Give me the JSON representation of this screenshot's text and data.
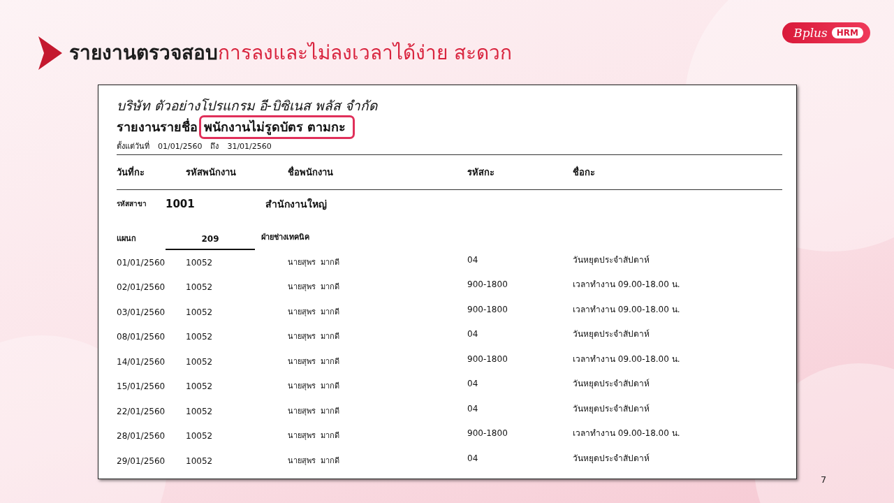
{
  "slide": {
    "title_lead": "รายงานตรวจสอบ",
    "title_rest": "การลงและไม่ลงเวลาได้ง่าย สะดวก",
    "page_number": "7"
  },
  "logo": {
    "brand": "Bplus",
    "badge": "HRM"
  },
  "report": {
    "company": "บริษัท ตัวอย่างโปรแกรม อี-บิซิเนส พลัส  จำกัด",
    "title": "รายงานรายชื่อ",
    "title_highlight": "พนักงานไม่รูดบัตร ตามกะ",
    "date_range": [
      "ตั้งแต่วันที่",
      "01/01/2560",
      "ถึง",
      "31/01/2560"
    ],
    "columns": [
      "วันที่กะ",
      "รหัสพนักงาน",
      "ชื่อพนักงาน",
      "รหัสกะ",
      "ชื่อกะ"
    ],
    "branch": {
      "label": "รหัสสาขา",
      "code": "1001",
      "name": "สำนักงานใหญ่"
    },
    "department": {
      "label": "แผนก",
      "code": "209",
      "name": "ฝ่ายช่างเทคนิค"
    },
    "rows": [
      {
        "date": "01/01/2560",
        "employee_code": "10052",
        "employee_name": "นายสุพร  มากดี",
        "shift_code": "04",
        "shift_name": "วันหยุดประจำสัปดาห์"
      },
      {
        "date": "02/01/2560",
        "employee_code": "10052",
        "employee_name": "นายสุพร  มากดี",
        "shift_code": "900-1800",
        "shift_name": "เวลาทำงาน 09.00-18.00 น."
      },
      {
        "date": "03/01/2560",
        "employee_code": "10052",
        "employee_name": "นายสุพร  มากดี",
        "shift_code": "900-1800",
        "shift_name": "เวลาทำงาน 09.00-18.00 น."
      },
      {
        "date": "08/01/2560",
        "employee_code": "10052",
        "employee_name": "นายสุพร  มากดี",
        "shift_code": "04",
        "shift_name": "วันหยุดประจำสัปดาห์"
      },
      {
        "date": "14/01/2560",
        "employee_code": "10052",
        "employee_name": "นายสุพร  มากดี",
        "shift_code": "900-1800",
        "shift_name": "เวลาทำงาน 09.00-18.00 น."
      },
      {
        "date": "15/01/2560",
        "employee_code": "10052",
        "employee_name": "นายสุพร  มากดี",
        "shift_code": "04",
        "shift_name": "วันหยุดประจำสัปดาห์"
      },
      {
        "date": "22/01/2560",
        "employee_code": "10052",
        "employee_name": "นายสุพร  มากดี",
        "shift_code": "04",
        "shift_name": "วันหยุดประจำสัปดาห์"
      },
      {
        "date": "28/01/2560",
        "employee_code": "10052",
        "employee_name": "นายสุพร  มากดี",
        "shift_code": "900-1800",
        "shift_name": "เวลาทำงาน 09.00-18.00 น."
      },
      {
        "date": "29/01/2560",
        "employee_code": "10052",
        "employee_name": "นายสุพร  มากดี",
        "shift_code": "04",
        "shift_name": "วันหยุดประจำสัปดาห์"
      }
    ]
  }
}
